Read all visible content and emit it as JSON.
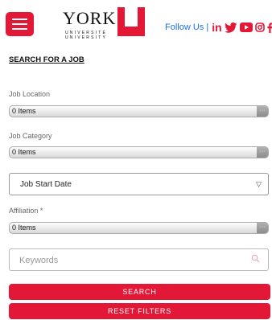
{
  "header": {
    "logo": {
      "word": "YORK",
      "line1": "UNIVERSITÉ",
      "line2": "UNIVERSITY",
      "letter": "U"
    },
    "follow_label": "Follow Us |",
    "social_icons": [
      "linkedin-icon",
      "twitter-icon",
      "youtube-icon",
      "instagram-icon",
      "facebook-icon"
    ],
    "accent_color": "#e31837"
  },
  "form": {
    "section_title": "SEARCH FOR A JOB",
    "job_location": {
      "label": "Job Location",
      "value": "0 Items"
    },
    "job_category": {
      "label": "Job Category",
      "value": "0 Items"
    },
    "job_start_date": {
      "label": "Job Start Date"
    },
    "affiliation": {
      "label": "Affiliation *",
      "value": "0 Items"
    },
    "keywords": {
      "placeholder": "Keywords",
      "value": ""
    },
    "search_label": "SEARCH",
    "reset_label": "RESET FILTERS"
  }
}
